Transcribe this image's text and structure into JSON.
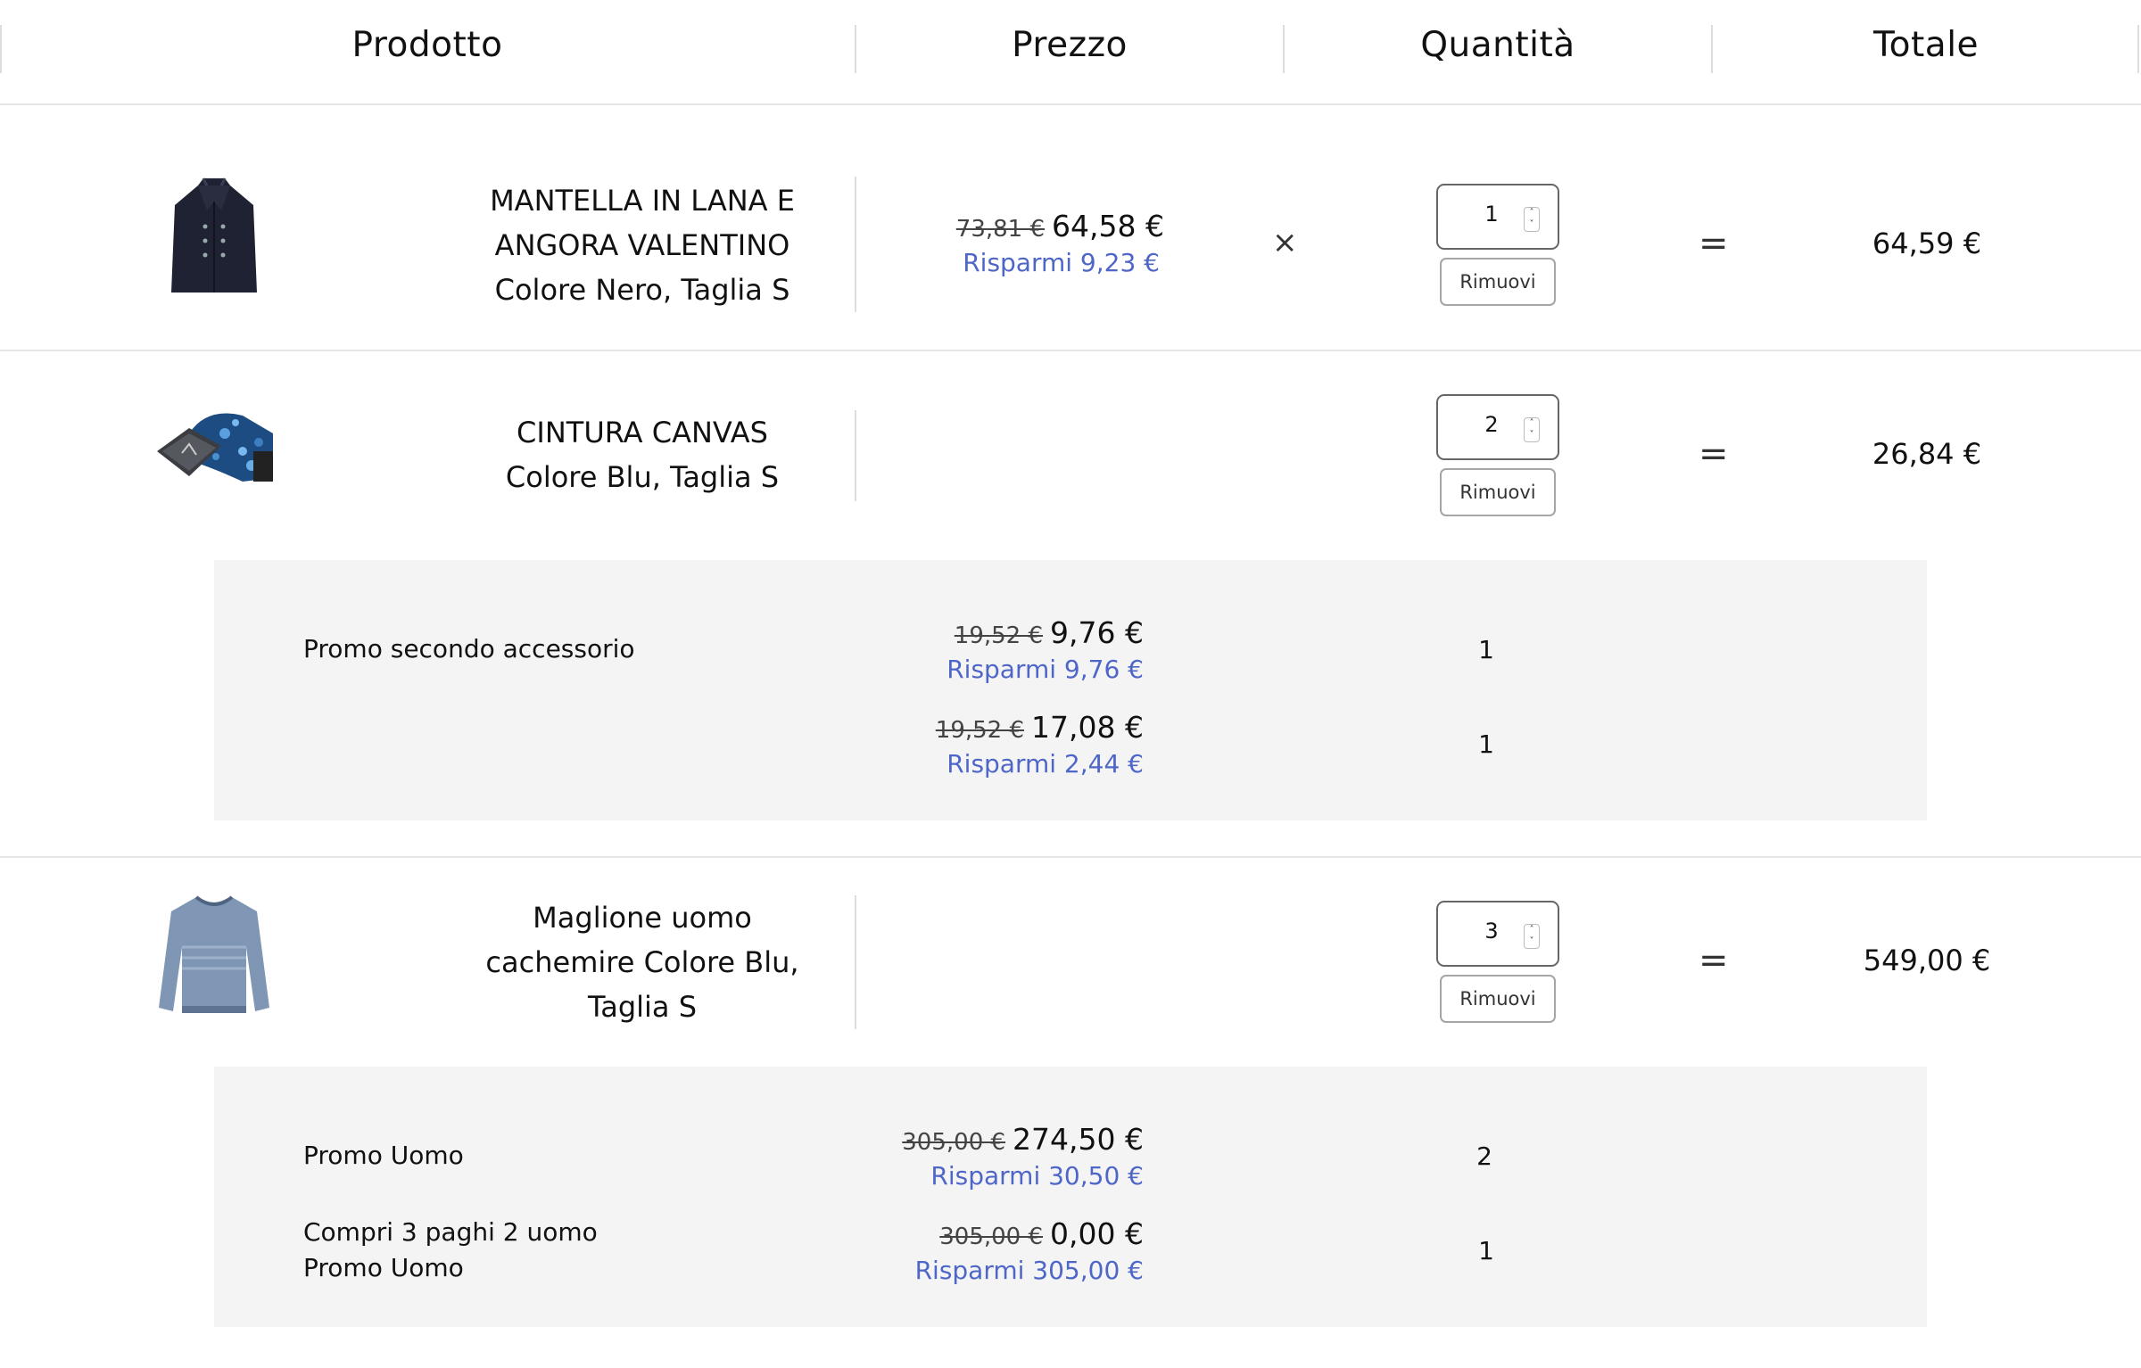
{
  "header": {
    "product": "Prodotto",
    "price": "Prezzo",
    "quantity": "Quantità",
    "total": "Totale"
  },
  "items": [
    {
      "name_line1": "MANTELLA IN LANA E",
      "name_line2": "ANGORA VALENTINO",
      "name_line3": "Colore Nero, Taglia S",
      "old_price": "73,81 €",
      "price": "64,58 €",
      "saving": "Risparmi 9,23 €",
      "multiply": "×",
      "qty": "1",
      "remove": "Rimuovi",
      "equals": "=",
      "total": "64,59 €",
      "image_icon": "coat-image"
    },
    {
      "name_line1": "CINTURA CANVAS",
      "name_line2": "Colore Blu, Taglia S",
      "qty": "2",
      "remove": "Rimuovi",
      "equals": "=",
      "total": "26,84 €",
      "image_icon": "belt-image",
      "promos": [
        {
          "label": "Promo secondo accessorio",
          "old_price": "19,52 €",
          "price": "9,76 €",
          "saving": "Risparmi 9,76 €",
          "qty": "1"
        },
        {
          "label": "",
          "old_price": "19,52 €",
          "price": "17,08 €",
          "saving": "Risparmi 2,44 €",
          "qty": "1"
        }
      ]
    },
    {
      "name_line1": "Maglione uomo",
      "name_line2": "cachemire Colore Blu,",
      "name_line3": "Taglia S",
      "qty": "3",
      "remove": "Rimuovi",
      "equals": "=",
      "total": "549,00 €",
      "image_icon": "sweater-image",
      "promos": [
        {
          "label": "Promo Uomo",
          "old_price": "305,00 €",
          "price": "274,50 €",
          "saving": "Risparmi 30,50 €",
          "qty": "2"
        },
        {
          "label_line1": "Compri 3 paghi 2 uomo",
          "label_line2": "Promo Uomo",
          "old_price": "305,00 €",
          "price": "0,00 €",
          "saving": "Risparmi 305,00 €",
          "qty": "1"
        }
      ]
    }
  ],
  "colors": {
    "saving": "#4f66c9",
    "promo_bg": "#f4f4f4",
    "divider": "#e6e6e6"
  }
}
